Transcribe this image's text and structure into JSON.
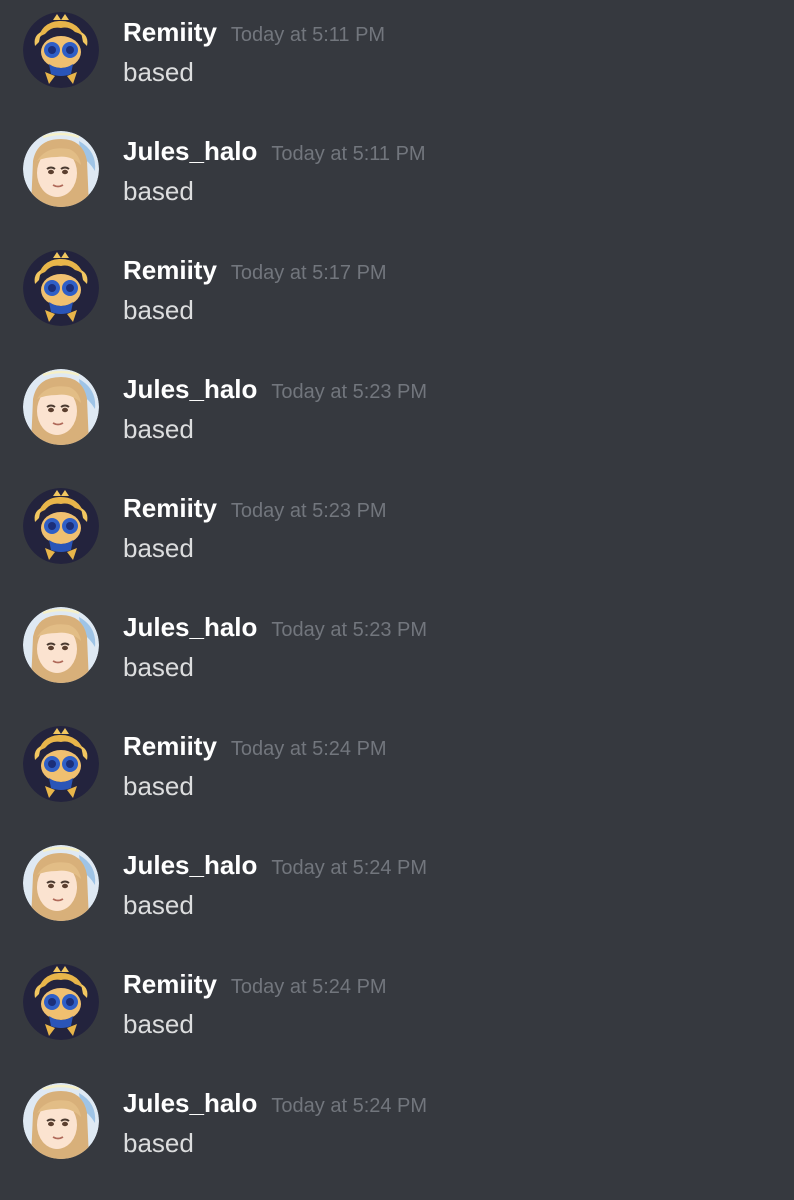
{
  "messages": [
    {
      "username": "Remiity",
      "timestamp": "Today at 5:11 PM",
      "content": "based",
      "avatar": "remiity"
    },
    {
      "username": "Jules_halo",
      "timestamp": "Today at 5:11 PM",
      "content": "based",
      "avatar": "jules"
    },
    {
      "username": "Remiity",
      "timestamp": "Today at 5:17 PM",
      "content": "based",
      "avatar": "remiity"
    },
    {
      "username": "Jules_halo",
      "timestamp": "Today at 5:23 PM",
      "content": "based",
      "avatar": "jules"
    },
    {
      "username": "Remiity",
      "timestamp": "Today at 5:23 PM",
      "content": "based",
      "avatar": "remiity"
    },
    {
      "username": "Jules_halo",
      "timestamp": "Today at 5:23 PM",
      "content": "based",
      "avatar": "jules"
    },
    {
      "username": "Remiity",
      "timestamp": "Today at 5:24 PM",
      "content": "based",
      "avatar": "remiity"
    },
    {
      "username": "Jules_halo",
      "timestamp": "Today at 5:24 PM",
      "content": "based",
      "avatar": "jules"
    },
    {
      "username": "Remiity",
      "timestamp": "Today at 5:24 PM",
      "content": "based",
      "avatar": "remiity"
    },
    {
      "username": "Jules_halo",
      "timestamp": "Today at 5:24 PM",
      "content": "based",
      "avatar": "jules"
    }
  ],
  "colors": {
    "background": "#36393f",
    "username": "#ffffff",
    "timestamp": "#72767d",
    "content": "#dcddde"
  }
}
